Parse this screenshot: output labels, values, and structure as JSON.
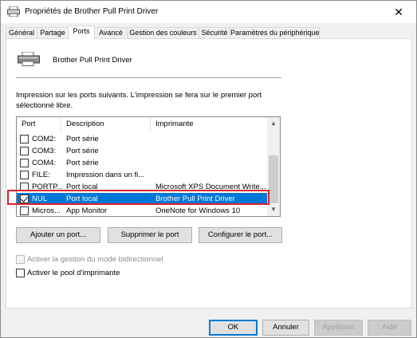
{
  "window": {
    "title": "Propriétés de Brother Pull Print Driver"
  },
  "tabs": [
    {
      "label": "Général"
    },
    {
      "label": "Partage"
    },
    {
      "label": "Ports"
    },
    {
      "label": "Avancé"
    },
    {
      "label": "Gestion des couleurs"
    },
    {
      "label": "Sécurité"
    },
    {
      "label": "Paramètres du périphérique"
    }
  ],
  "active_tab": "Ports",
  "printer": {
    "name": "Brother Pull Print Driver"
  },
  "description": "Impression sur les ports suivants. L'impression se fera sur le premier port sélectionné libre.",
  "ports_table": {
    "columns": [
      "Port",
      "Description",
      "Imprimante"
    ],
    "rows": [
      {
        "port": "COM2:",
        "description": "Port série",
        "printer": "",
        "checked": false,
        "selected": false
      },
      {
        "port": "COM3:",
        "description": "Port série",
        "printer": "",
        "checked": false,
        "selected": false
      },
      {
        "port": "COM4:",
        "description": "Port série",
        "printer": "",
        "checked": false,
        "selected": false
      },
      {
        "port": "FILE:",
        "description": "Impression dans un fi...",
        "printer": "",
        "checked": false,
        "selected": false
      },
      {
        "port": "PORTP...",
        "description": "Port local",
        "printer": "Microsoft XPS Document Write...",
        "checked": false,
        "selected": false
      },
      {
        "port": "NUL",
        "description": "Port local",
        "printer": "Brother Pull Print Driver",
        "checked": true,
        "selected": true
      },
      {
        "port": "Micros...",
        "description": "App Monitor",
        "printer": "OneNote for Windows 10",
        "checked": false,
        "selected": false
      }
    ]
  },
  "buttons": {
    "add_port": "Ajouter un port...",
    "delete_port": "Supprimer le port",
    "configure_port": "Configurer le port..."
  },
  "options": {
    "bidirectional": {
      "label": "Activer la gestion du mode bidirectionnel",
      "checked": false,
      "enabled": false
    },
    "pool": {
      "label": "Activer le pool d'imprimante",
      "checked": false,
      "enabled": true
    }
  },
  "footer": {
    "ok": "OK",
    "cancel": "Annuler",
    "apply": "Appliquer",
    "help": "Aide"
  },
  "colors": {
    "selection": "#0078d7",
    "highlight_box": "#d9202d"
  }
}
